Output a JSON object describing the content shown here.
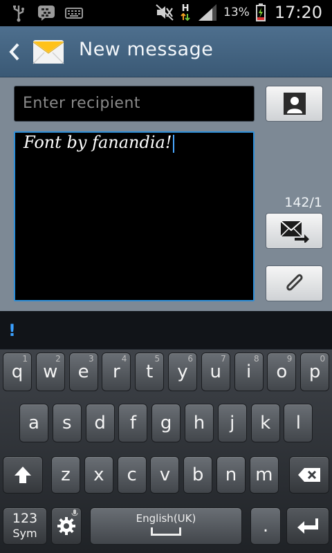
{
  "status_bar": {
    "network_type": "H",
    "battery_percent": "13%",
    "time": "17:20"
  },
  "header": {
    "title": "New message"
  },
  "compose": {
    "recipient_placeholder": "Enter recipient",
    "message_text": "Font by fanandia!",
    "char_counter": "142/1"
  },
  "suggestion": {
    "text": "!"
  },
  "keyboard": {
    "row1": [
      {
        "char": "q",
        "num": "1"
      },
      {
        "char": "w",
        "num": "2"
      },
      {
        "char": "e",
        "num": "3"
      },
      {
        "char": "r",
        "num": "4"
      },
      {
        "char": "t",
        "num": "5"
      },
      {
        "char": "y",
        "num": "6"
      },
      {
        "char": "u",
        "num": "7"
      },
      {
        "char": "i",
        "num": "8"
      },
      {
        "char": "o",
        "num": "9"
      },
      {
        "char": "p",
        "num": "0"
      }
    ],
    "row2": [
      "a",
      "s",
      "d",
      "f",
      "g",
      "h",
      "j",
      "k",
      "l"
    ],
    "row3": [
      "z",
      "x",
      "c",
      "v",
      "b",
      "n",
      "m"
    ],
    "sym_label_top": "123",
    "sym_label_bottom": "Sym",
    "language_label": "English(UK)",
    "period": "."
  },
  "icons": {
    "back": "chevron-left-icon",
    "app": "envelope-icon",
    "contacts": "contact-icon",
    "send": "send-icon",
    "attach": "paperclip-icon",
    "shift": "shift-icon",
    "backspace": "backspace-icon",
    "settings": "gear-icon",
    "enter": "enter-icon"
  },
  "colors": {
    "title_bar": "#4e6f8e",
    "compose_bg": "#7d8995",
    "focus_border": "#2f8fd8",
    "suggestion": "#3aa0ff"
  }
}
